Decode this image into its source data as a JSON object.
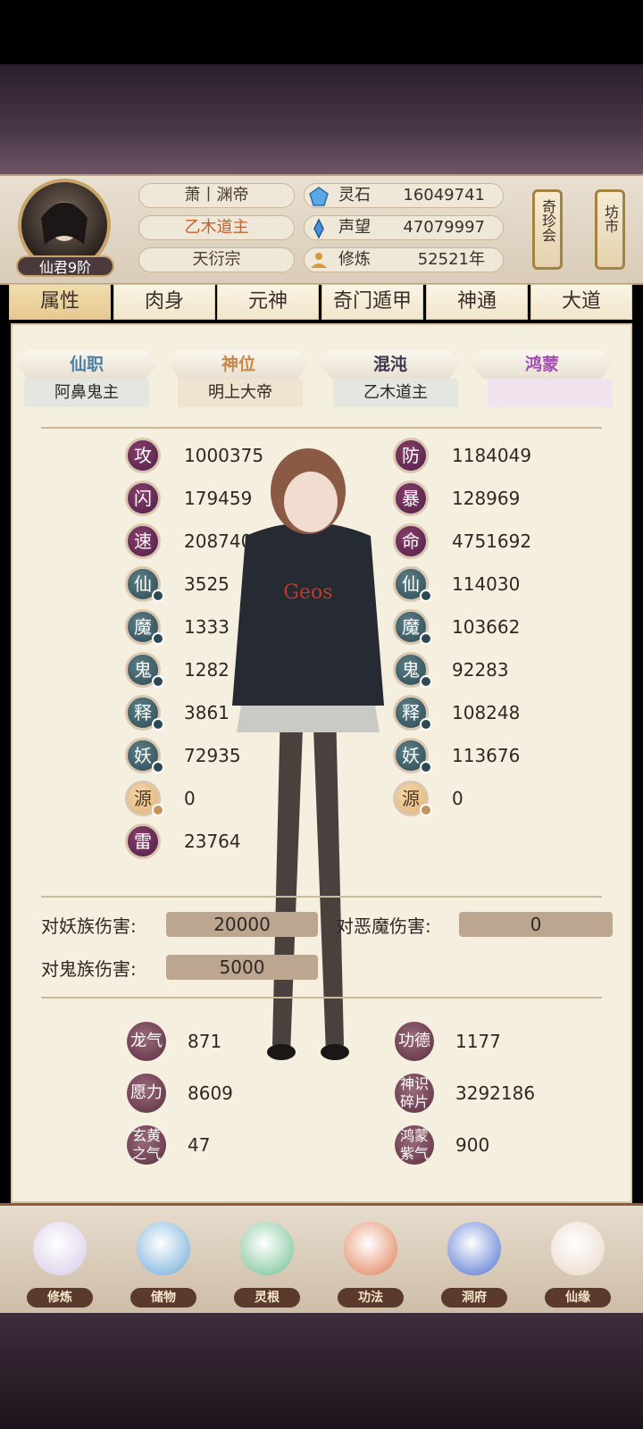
{
  "header": {
    "rank": "仙君9阶",
    "player_name": "萧丨渊帝",
    "title": "乙木道主",
    "sect": "天衍宗",
    "resources": [
      {
        "label": "灵石",
        "value": "16049741",
        "icon": "spirit-stone-icon"
      },
      {
        "label": "声望",
        "value": "47079997",
        "icon": "reputation-icon"
      },
      {
        "label": "修炼",
        "value": "52521年",
        "icon": "cultivation-icon"
      }
    ],
    "side_buttons": [
      "奇珍会",
      "坊市"
    ]
  },
  "tabs": [
    "属性",
    "肉身",
    "元神",
    "奇门遁甲",
    "神通",
    "大道"
  ],
  "active_tab": "属性",
  "rank_tabs": [
    {
      "label": "仙职",
      "value": "阿鼻鬼主",
      "color": "#4c7fa6"
    },
    {
      "label": "神位",
      "value": "明上大帝",
      "color": "#c8874a"
    },
    {
      "label": "混沌",
      "value": "乙木道主",
      "color": "#3d3550"
    },
    {
      "label": "鸿蒙",
      "value": "",
      "color": "#a24fb0"
    }
  ],
  "stats_left": [
    {
      "icon": "攻",
      "value": "1000375",
      "style": "red"
    },
    {
      "icon": "闪",
      "value": "179459",
      "style": "red"
    },
    {
      "icon": "速",
      "value": "208740",
      "style": "red"
    },
    {
      "icon": "仙",
      "value": "3525",
      "style": "teal"
    },
    {
      "icon": "魔",
      "value": "1333",
      "style": "teal"
    },
    {
      "icon": "鬼",
      "value": "1282",
      "style": "teal"
    },
    {
      "icon": "释",
      "value": "3861",
      "style": "teal"
    },
    {
      "icon": "妖",
      "value": "72935",
      "style": "teal"
    },
    {
      "icon": "源",
      "value": "0",
      "style": "gold"
    },
    {
      "icon": "雷",
      "value": "23764",
      "style": "red"
    }
  ],
  "stats_right": [
    {
      "icon": "防",
      "value": "1184049",
      "style": "red"
    },
    {
      "icon": "暴",
      "value": "128969",
      "style": "red"
    },
    {
      "icon": "命",
      "value": "4751692",
      "style": "red"
    },
    {
      "icon": "仙",
      "value": "114030",
      "style": "teal"
    },
    {
      "icon": "魔",
      "value": "103662",
      "style": "teal"
    },
    {
      "icon": "鬼",
      "value": "92283",
      "style": "teal"
    },
    {
      "icon": "释",
      "value": "108248",
      "style": "teal"
    },
    {
      "icon": "妖",
      "value": "113676",
      "style": "teal"
    },
    {
      "icon": "源",
      "value": "0",
      "style": "gold"
    }
  ],
  "damage": {
    "yao_label": "对妖族伤害:",
    "yao_value": "20000",
    "emo_label": "对恶魔伤害:",
    "emo_value": "0",
    "gui_label": "对鬼族伤害:",
    "gui_value": "5000"
  },
  "resources2": [
    {
      "icon": "龙气",
      "value": "871"
    },
    {
      "icon": "功德",
      "value": "1177"
    },
    {
      "icon": "愿力",
      "value": "8609"
    },
    {
      "icon": "神识碎片",
      "value": "3292186"
    },
    {
      "icon": "玄黄之气",
      "value": "47"
    },
    {
      "icon": "鸿蒙紫气",
      "value": "900"
    }
  ],
  "bottom_nav": [
    "修炼",
    "储物",
    "灵根",
    "功法",
    "洞府",
    "仙缘"
  ]
}
